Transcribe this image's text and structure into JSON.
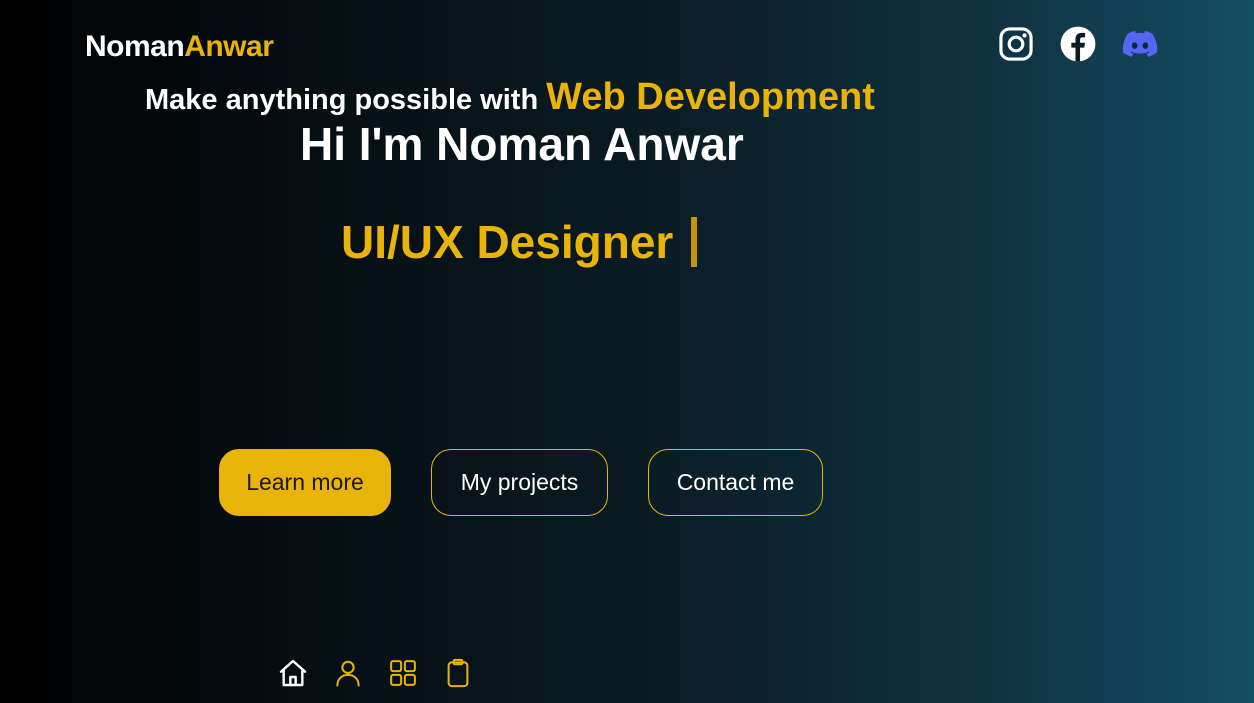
{
  "brand": {
    "first": "Noman",
    "last": "Anwar"
  },
  "socials": [
    {
      "name": "instagram-icon",
      "color": "#ffffff"
    },
    {
      "name": "facebook-icon",
      "color": "#ffffff"
    },
    {
      "name": "discord-icon",
      "color": "#5865f2"
    }
  ],
  "hero": {
    "tagline_lead": "Make anything possible with",
    "tagline_accent": "Web Development",
    "greeting": "Hi I'm Noman Anwar",
    "role": "UI/UX Designer"
  },
  "buttons": {
    "learn_more": "Learn more",
    "projects": "My projects",
    "contact": "Contact me"
  },
  "bottom_nav": [
    {
      "name": "home-icon",
      "active": true
    },
    {
      "name": "user-icon",
      "active": false
    },
    {
      "name": "grid-icon",
      "active": false
    },
    {
      "name": "clipboard-icon",
      "active": false
    }
  ],
  "colors": {
    "accent": "#eab308",
    "white": "#ffffff",
    "discord": "#5865f2"
  }
}
